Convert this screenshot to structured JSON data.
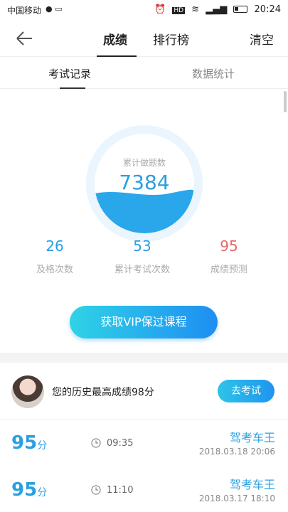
{
  "status_bar": {
    "carrier": "中国移动",
    "time": "20:24",
    "icons": [
      "wechat-icon",
      "app-icon",
      "alarm-icon",
      "hd-icon",
      "wifi-icon",
      "signal-icon",
      "battery-icon"
    ],
    "hd_label": "HD"
  },
  "header": {
    "tabs": [
      {
        "label": "成绩",
        "active": true
      },
      {
        "label": "排行榜",
        "active": false
      }
    ],
    "clear_label": "清空"
  },
  "subtabs": [
    {
      "label": "考试记录",
      "active": true
    },
    {
      "label": "数据统计",
      "active": false
    }
  ],
  "summary": {
    "gauge_label": "累计做题数",
    "gauge_value": "7384",
    "gauge_fill_fraction": 0.4,
    "stats": [
      {
        "value": "26",
        "label": "及格次数"
      },
      {
        "value": "53",
        "label": "累计考试次数"
      },
      {
        "value": "95",
        "label": "成绩预测"
      }
    ],
    "vip_button": "获取VIP保过课程"
  },
  "best": {
    "text": "您的历史最高成绩98分",
    "button": "去考试"
  },
  "records": [
    {
      "score": "95",
      "unit": "分",
      "duration": "09:35",
      "name": "驾考车王",
      "date": "2018.03.18  20:06"
    },
    {
      "score": "95",
      "unit": "分",
      "duration": "11:10",
      "name": "驾考车王",
      "date": "2018.03.17  18:10"
    }
  ],
  "colors": {
    "accent": "#2a9fe0",
    "prediction": "#e26a6a",
    "vip_gradient_start": "#2fd3e6",
    "vip_gradient_end": "#1e8ef2"
  }
}
